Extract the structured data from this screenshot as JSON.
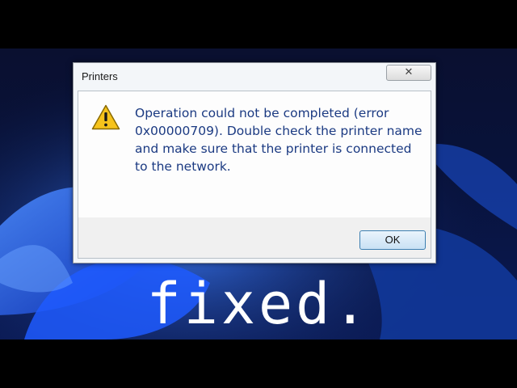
{
  "dialog": {
    "title": "Printers",
    "close_glyph": "✕",
    "icon": "warning-icon",
    "message": "Operation could not be completed (error 0x00000709). Double check the printer name and make sure that the printer is connected to the network.",
    "ok_label": "OK"
  },
  "overlay": {
    "caption": "fixed."
  },
  "colors": {
    "message_text": "#1b3a82",
    "wallpaper_blue": "#1e5bff",
    "warning_yellow": "#f6c31c"
  }
}
